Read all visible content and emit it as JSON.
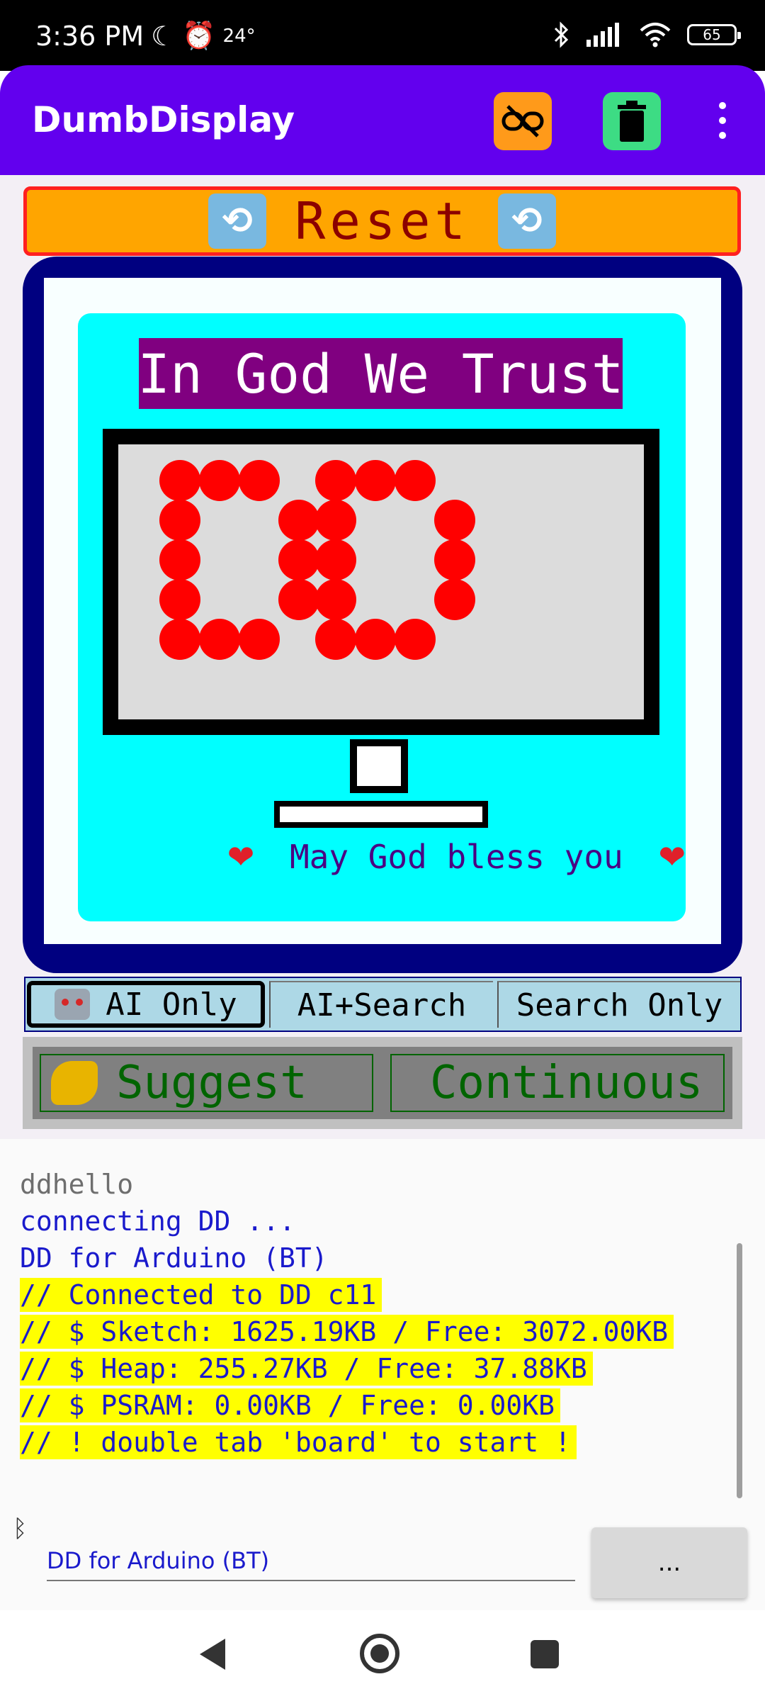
{
  "status_bar": {
    "time": "3:36 PM",
    "temperature": "24°",
    "battery": "65"
  },
  "app_bar": {
    "title": "DumbDisplay",
    "link_button_color": "#ff9a1a",
    "trash_button_color": "#3ddc84",
    "accent": "#6200ee"
  },
  "dd": {
    "reset_label": "Reset",
    "banner_text": "In God We Trust",
    "blessing_text": "May God bless you",
    "heart_glyph": "❤",
    "led_color": "#ff0000",
    "modes": [
      "AI Only",
      "AI+Search",
      "Search Only"
    ],
    "selected_mode": "AI Only",
    "suggest_label": "Suggest",
    "continuous_label": "Continuous"
  },
  "log": [
    {
      "text": "ddhello",
      "style": "gray"
    },
    {
      "text": "connecting DD ...",
      "style": "blue"
    },
    {
      "text": "DD for Arduino (BT)",
      "style": "blue"
    },
    {
      "text": "// Connected to DD c11",
      "style": "highlight"
    },
    {
      "text": "// $ Sketch: 1625.19KB / Free: 3072.00KB",
      "style": "highlight"
    },
    {
      "text": "// $ Heap: 255.27KB / Free: 37.88KB",
      "style": "highlight"
    },
    {
      "text": "// $ PSRAM: 0.00KB / Free: 0.00KB",
      "style": "highlight"
    },
    {
      "text": "// ! double tab 'board' to start !",
      "style": "highlight"
    }
  ],
  "input": {
    "value": "DD for Arduino (BT)",
    "more_label": "..."
  }
}
